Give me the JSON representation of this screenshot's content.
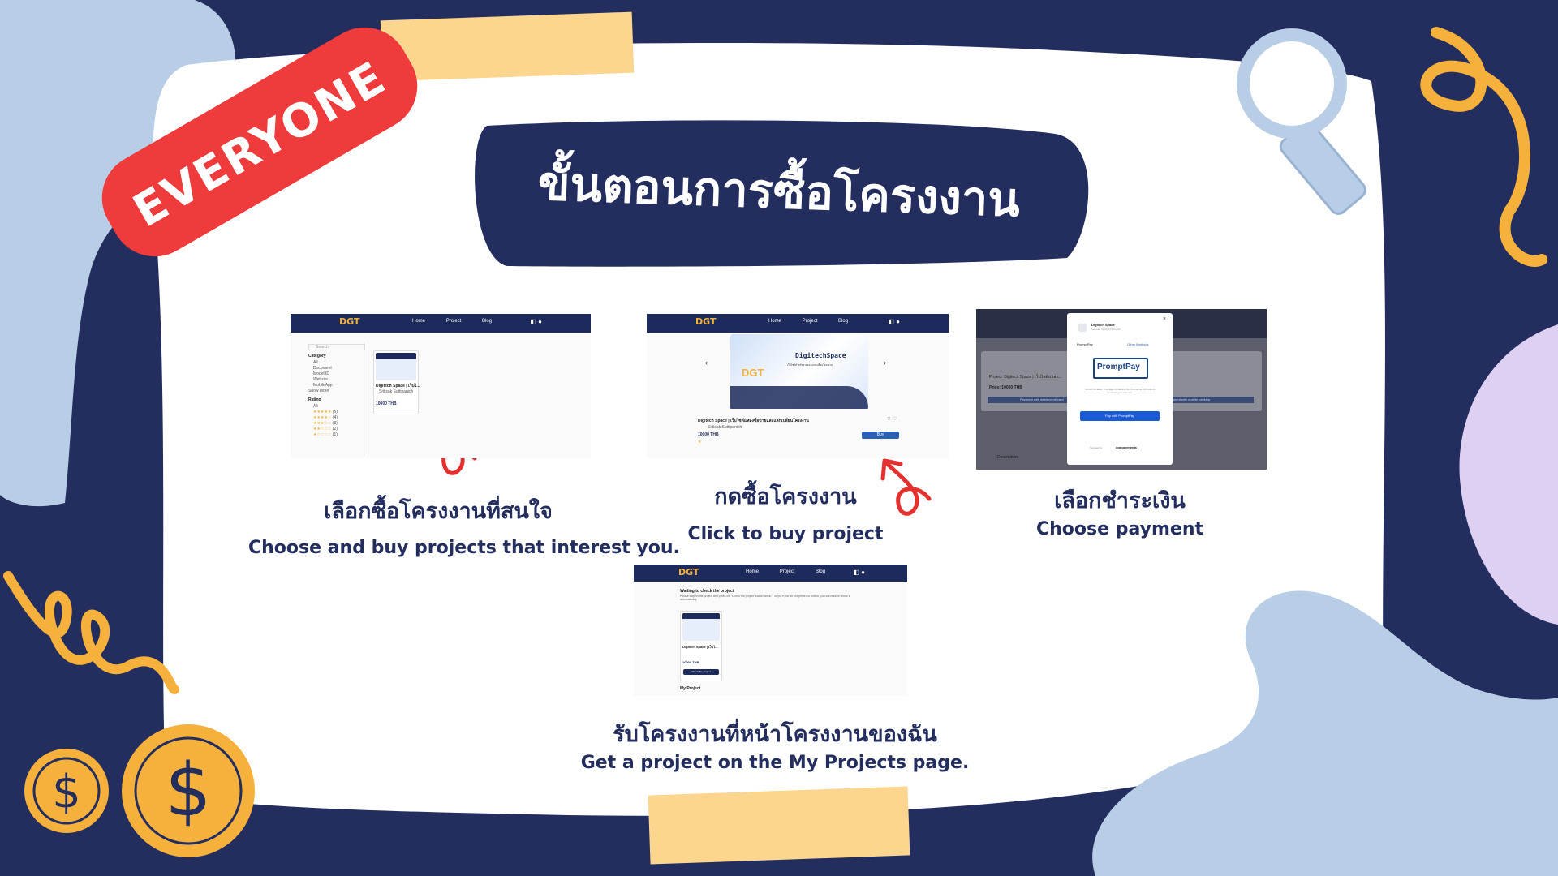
{
  "banner": {
    "badge": "EVERYONE",
    "heading": "ขั้นตอนการซื้อโครงงาน"
  },
  "steps": [
    {
      "title_th": "เลือกซื้อโครงงานที่สนใจ",
      "subtitle_en": "Choose and buy projects that interest you."
    },
    {
      "title_th": "กดซื้อโครงงาน",
      "subtitle_en": "Click to buy project"
    },
    {
      "title_th": "เลือกชำระเงิน",
      "subtitle_en": "Choose payment"
    },
    {
      "title_th": "รับโครงงานที่หน้าโครงงานของฉัน",
      "subtitle_en": "Get a project on the My Projects page."
    }
  ],
  "screenshots": {
    "nav": {
      "logo": "DGT",
      "links": [
        "Home",
        "Project",
        "Blog"
      ]
    },
    "shot1": {
      "search_placeholder": "Search",
      "category_heading": "Category",
      "categories": [
        "All",
        "Document",
        "Model3D",
        "Website",
        "MobileApp",
        "Show More"
      ],
      "rating_heading": "Rating",
      "ratings": [
        "All",
        "(5)",
        "(4)",
        "(3)",
        "(2)",
        "(1)"
      ],
      "card_title": "Digitech Space | เว็บไ...",
      "card_author": "Sittisak Suttipanich",
      "card_price": "10000 THB"
    },
    "shot2": {
      "banner_title": "DigitechSpace",
      "banner_subtitle": "เว็บไซต์สำหรับขายและแลกเปลี่ยนโครงงาน",
      "project_title": "Digitech Space | เว็บไซต์แหล่งซื้อขายและแลกเปลี่ยนโครงงาน",
      "author": "Sittisak Suttipanich",
      "price": "10000 THB",
      "buy_label": "Buy"
    },
    "shot3": {
      "merchant": "Digitech Space",
      "merchant_sub": "Secured by Opn Payments",
      "method_label": "PromptPay",
      "other_methods": "Other Methods",
      "logo_text": "PromptPay",
      "note": "You will be taken to a page containing the PromptPay QR code to complete your payment.",
      "pay_button": "Pay with PromptPay",
      "secured_by": "Secured by",
      "provider": "opnpayments",
      "bg_project": "Project: Digitech Space | เว็บไซต์แหล่ง...",
      "bg_price": "Price: 10000 THB",
      "bg_btn_left": "Payment with debit/credit card",
      "bg_btn_right": "Payment with mobile banking",
      "bg_description": "Description"
    },
    "shot4": {
      "waiting_title": "Waiting to check the project",
      "waiting_text": "Please inspect the project and press the 'Check the project' button within 7 days. If you do not press the button, you will resolve check it automatically.",
      "card_title": "Digitech Space | เว็บไ...",
      "card_price": "10000 THB",
      "check_button": "Check the project",
      "my_project": "My Project"
    }
  },
  "colors": {
    "navy": "#232e5f",
    "light_blue": "#b8cde6",
    "yellow": "#f6b13c",
    "red_badge": "#ef3b3b",
    "tape": "#fcd58f",
    "lavender": "#ddd0f2"
  },
  "icons": [
    "magnifier-icon",
    "dollar-coin-icon",
    "squiggle-icon",
    "red-arrow-icon"
  ]
}
